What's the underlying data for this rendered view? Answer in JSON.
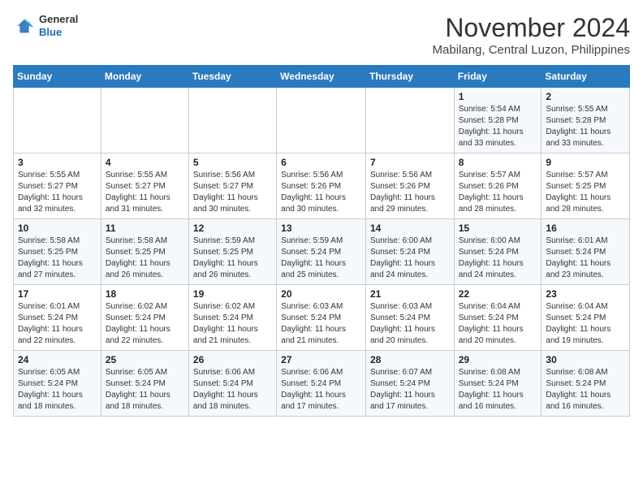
{
  "header": {
    "logo_general": "General",
    "logo_blue": "Blue",
    "month_year": "November 2024",
    "location": "Mabilang, Central Luzon, Philippines"
  },
  "weekdays": [
    "Sunday",
    "Monday",
    "Tuesday",
    "Wednesday",
    "Thursday",
    "Friday",
    "Saturday"
  ],
  "weeks": [
    [
      {
        "day": "",
        "info": ""
      },
      {
        "day": "",
        "info": ""
      },
      {
        "day": "",
        "info": ""
      },
      {
        "day": "",
        "info": ""
      },
      {
        "day": "",
        "info": ""
      },
      {
        "day": "1",
        "info": "Sunrise: 5:54 AM\nSunset: 5:28 PM\nDaylight: 11 hours and 33 minutes."
      },
      {
        "day": "2",
        "info": "Sunrise: 5:55 AM\nSunset: 5:28 PM\nDaylight: 11 hours and 33 minutes."
      }
    ],
    [
      {
        "day": "3",
        "info": "Sunrise: 5:55 AM\nSunset: 5:27 PM\nDaylight: 11 hours and 32 minutes."
      },
      {
        "day": "4",
        "info": "Sunrise: 5:55 AM\nSunset: 5:27 PM\nDaylight: 11 hours and 31 minutes."
      },
      {
        "day": "5",
        "info": "Sunrise: 5:56 AM\nSunset: 5:27 PM\nDaylight: 11 hours and 30 minutes."
      },
      {
        "day": "6",
        "info": "Sunrise: 5:56 AM\nSunset: 5:26 PM\nDaylight: 11 hours and 30 minutes."
      },
      {
        "day": "7",
        "info": "Sunrise: 5:56 AM\nSunset: 5:26 PM\nDaylight: 11 hours and 29 minutes."
      },
      {
        "day": "8",
        "info": "Sunrise: 5:57 AM\nSunset: 5:26 PM\nDaylight: 11 hours and 28 minutes."
      },
      {
        "day": "9",
        "info": "Sunrise: 5:57 AM\nSunset: 5:25 PM\nDaylight: 11 hours and 28 minutes."
      }
    ],
    [
      {
        "day": "10",
        "info": "Sunrise: 5:58 AM\nSunset: 5:25 PM\nDaylight: 11 hours and 27 minutes."
      },
      {
        "day": "11",
        "info": "Sunrise: 5:58 AM\nSunset: 5:25 PM\nDaylight: 11 hours and 26 minutes."
      },
      {
        "day": "12",
        "info": "Sunrise: 5:59 AM\nSunset: 5:25 PM\nDaylight: 11 hours and 26 minutes."
      },
      {
        "day": "13",
        "info": "Sunrise: 5:59 AM\nSunset: 5:24 PM\nDaylight: 11 hours and 25 minutes."
      },
      {
        "day": "14",
        "info": "Sunrise: 6:00 AM\nSunset: 5:24 PM\nDaylight: 11 hours and 24 minutes."
      },
      {
        "day": "15",
        "info": "Sunrise: 6:00 AM\nSunset: 5:24 PM\nDaylight: 11 hours and 24 minutes."
      },
      {
        "day": "16",
        "info": "Sunrise: 6:01 AM\nSunset: 5:24 PM\nDaylight: 11 hours and 23 minutes."
      }
    ],
    [
      {
        "day": "17",
        "info": "Sunrise: 6:01 AM\nSunset: 5:24 PM\nDaylight: 11 hours and 22 minutes."
      },
      {
        "day": "18",
        "info": "Sunrise: 6:02 AM\nSunset: 5:24 PM\nDaylight: 11 hours and 22 minutes."
      },
      {
        "day": "19",
        "info": "Sunrise: 6:02 AM\nSunset: 5:24 PM\nDaylight: 11 hours and 21 minutes."
      },
      {
        "day": "20",
        "info": "Sunrise: 6:03 AM\nSunset: 5:24 PM\nDaylight: 11 hours and 21 minutes."
      },
      {
        "day": "21",
        "info": "Sunrise: 6:03 AM\nSunset: 5:24 PM\nDaylight: 11 hours and 20 minutes."
      },
      {
        "day": "22",
        "info": "Sunrise: 6:04 AM\nSunset: 5:24 PM\nDaylight: 11 hours and 20 minutes."
      },
      {
        "day": "23",
        "info": "Sunrise: 6:04 AM\nSunset: 5:24 PM\nDaylight: 11 hours and 19 minutes."
      }
    ],
    [
      {
        "day": "24",
        "info": "Sunrise: 6:05 AM\nSunset: 5:24 PM\nDaylight: 11 hours and 18 minutes."
      },
      {
        "day": "25",
        "info": "Sunrise: 6:05 AM\nSunset: 5:24 PM\nDaylight: 11 hours and 18 minutes."
      },
      {
        "day": "26",
        "info": "Sunrise: 6:06 AM\nSunset: 5:24 PM\nDaylight: 11 hours and 18 minutes."
      },
      {
        "day": "27",
        "info": "Sunrise: 6:06 AM\nSunset: 5:24 PM\nDaylight: 11 hours and 17 minutes."
      },
      {
        "day": "28",
        "info": "Sunrise: 6:07 AM\nSunset: 5:24 PM\nDaylight: 11 hours and 17 minutes."
      },
      {
        "day": "29",
        "info": "Sunrise: 6:08 AM\nSunset: 5:24 PM\nDaylight: 11 hours and 16 minutes."
      },
      {
        "day": "30",
        "info": "Sunrise: 6:08 AM\nSunset: 5:24 PM\nDaylight: 11 hours and 16 minutes."
      }
    ]
  ]
}
